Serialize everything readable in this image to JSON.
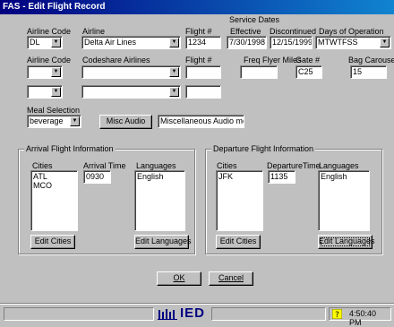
{
  "window": {
    "title": "FAS - Edit Flight Record"
  },
  "header": {
    "service_dates": "Service Dates",
    "airline_code": "Airline Code",
    "airline": "Airline",
    "flight_no": "Flight #",
    "effective": "Effective",
    "discontinued": "Discontinued",
    "days_of_operation": "Days of Operation"
  },
  "row1": {
    "airline_code": "DL",
    "airline": "Delta Air Lines",
    "flight_no": "1234",
    "effective": "7/30/1998",
    "discontinued": "12/15/1999",
    "days": "MTWTFSS"
  },
  "codeshare": {
    "airline_code_label": "Airline Code",
    "airlines_label": "Codeshare Airlines",
    "flight_label": "Flight #",
    "freq_flyer_label": "Freq Flyer Miles",
    "gate_label": "Gate #",
    "bag_label": "Bag Carousel",
    "gate_value": "C25",
    "bag_value": "15"
  },
  "meal": {
    "label": "Meal Selection",
    "value": "beverage",
    "misc_button": "Misc Audio",
    "misc_value": "Miscellaneous Audio messa"
  },
  "arrival": {
    "title": "Arrival Flight Information",
    "cities_label": "Cities",
    "time_label": "Arrival Time",
    "lang_label": "Languages",
    "cities": [
      "ATL",
      "MCO"
    ],
    "time": "0930",
    "languages": [
      "English"
    ],
    "edit_cities": "Edit Cities",
    "edit_languages": "Edit Languages"
  },
  "departure": {
    "title": "Departure Flight Information",
    "cities_label": "Cities",
    "time_label": "DepartureTime",
    "lang_label": "Languages",
    "cities": [
      "JFK"
    ],
    "time": "1135",
    "languages": [
      "English"
    ],
    "edit_cities": "Edit Cities",
    "edit_languages": "Edit Languages"
  },
  "buttons": {
    "ok": "OK",
    "cancel": "Cancel"
  },
  "statusbar": {
    "logo": "IED",
    "time": "4:50:40 PM"
  },
  "icons": {
    "dropdown": "chevron-down-icon",
    "status": "help-icon"
  }
}
